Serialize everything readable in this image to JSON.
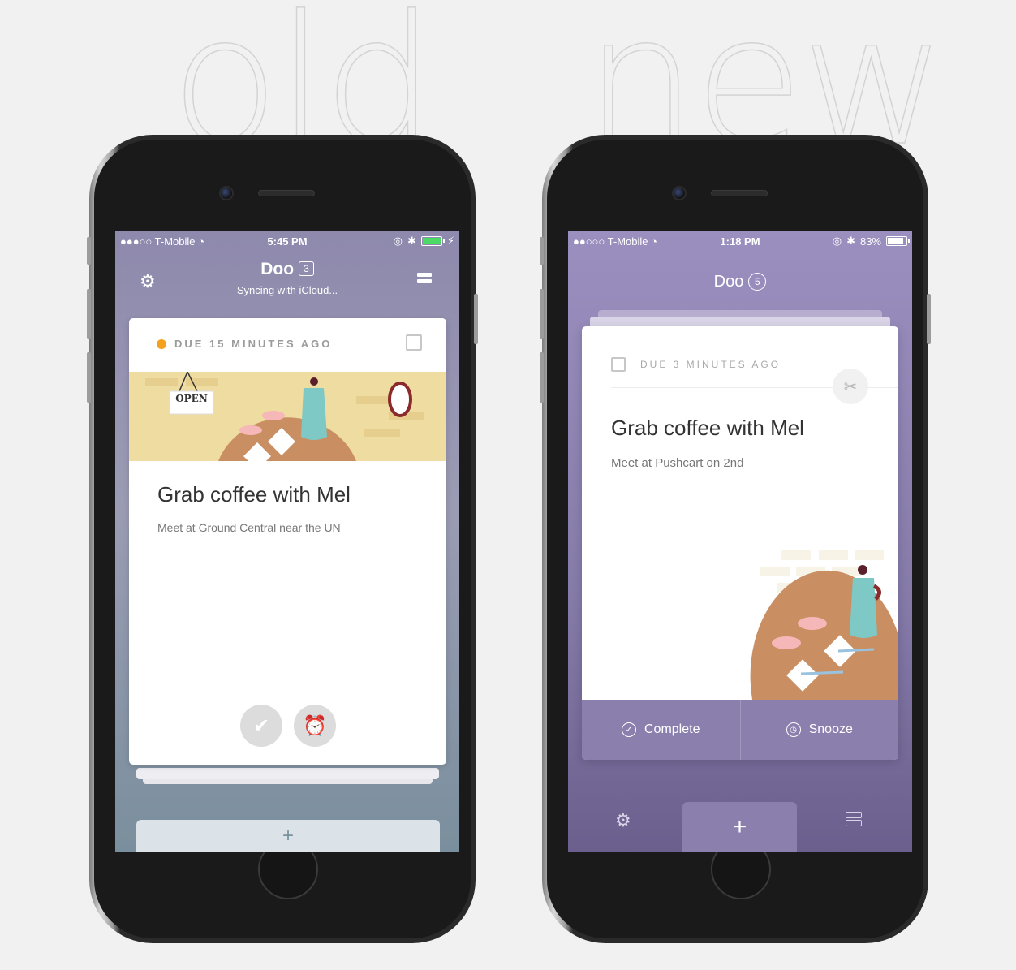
{
  "labels": {
    "old": "old",
    "new": "new"
  },
  "old_screen": {
    "status": {
      "carrier": "●●●○○ T-Mobile",
      "time": "5:45 PM"
    },
    "header": {
      "app_name": "Doo",
      "count": "3",
      "subtitle": "Syncing with iCloud..."
    },
    "card": {
      "due": "DUE 15 MINUTES AGO",
      "sign": "OPEN",
      "title": "Grab coffee with Mel",
      "note": "Meet at Ground Central near the UN"
    },
    "add_label": "+"
  },
  "new_screen": {
    "status": {
      "carrier": "●●○○○ T-Mobile",
      "time": "1:18 PM",
      "battery": "83%"
    },
    "header": {
      "app_name": "Doo",
      "count": "5"
    },
    "card": {
      "due": "DUE 3 MINUTES AGO",
      "title": "Grab coffee with Mel",
      "note": "Meet at Pushcart on 2nd"
    },
    "actions": {
      "complete": "Complete",
      "snooze": "Snooze"
    },
    "add_label": "+"
  },
  "colors": {
    "old_due_dot": "#f4a21c",
    "old_battery": "#4cd964",
    "new_accent": "#8b7fae"
  }
}
